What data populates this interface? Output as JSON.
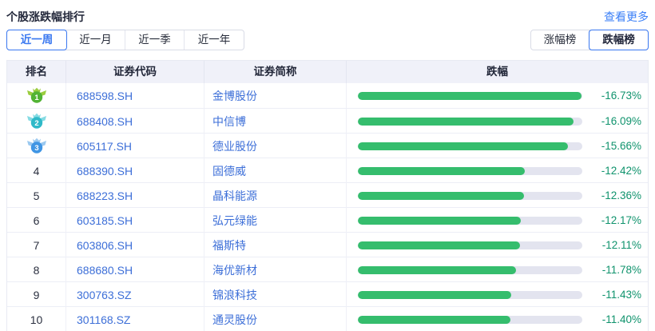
{
  "header": {
    "title": "个股涨跌幅排行",
    "more_link": "查看更多"
  },
  "tabs": {
    "items": [
      {
        "label": "近一周",
        "active": true
      },
      {
        "label": "近一月",
        "active": false
      },
      {
        "label": "近一季",
        "active": false
      },
      {
        "label": "近一年",
        "active": false
      }
    ]
  },
  "toggle": {
    "items": [
      {
        "label": "涨幅榜",
        "active": false
      },
      {
        "label": "跌幅榜",
        "active": true
      }
    ]
  },
  "table": {
    "columns": [
      "排名",
      "证券代码",
      "证券简称",
      "跌幅"
    ],
    "rows": [
      {
        "rank": 1,
        "code": "688598.SH",
        "name": "金博股份",
        "change": "-16.73%",
        "bar_pct": 99.5,
        "medal": {
          "body": "#52b334",
          "wing": "#9bcd3f"
        }
      },
      {
        "rank": 2,
        "code": "688408.SH",
        "name": "中信博",
        "change": "-16.09%",
        "bar_pct": 96.2,
        "medal": {
          "body": "#2fb9c8",
          "wing": "#85dbe3"
        }
      },
      {
        "rank": 3,
        "code": "605117.SH",
        "name": "德业股份",
        "change": "-15.66%",
        "bar_pct": 93.6,
        "medal": {
          "body": "#3f95e4",
          "wing": "#9bc9f0"
        }
      },
      {
        "rank": 4,
        "code": "688390.SH",
        "name": "固德威",
        "change": "-12.42%",
        "bar_pct": 74.2,
        "medal": null
      },
      {
        "rank": 5,
        "code": "688223.SH",
        "name": "晶科能源",
        "change": "-12.36%",
        "bar_pct": 73.9,
        "medal": null
      },
      {
        "rank": 6,
        "code": "603185.SH",
        "name": "弘元绿能",
        "change": "-12.17%",
        "bar_pct": 72.7,
        "medal": null
      },
      {
        "rank": 7,
        "code": "603806.SH",
        "name": "福斯特",
        "change": "-12.11%",
        "bar_pct": 72.4,
        "medal": null
      },
      {
        "rank": 8,
        "code": "688680.SH",
        "name": "海优新材",
        "change": "-11.78%",
        "bar_pct": 70.4,
        "medal": null
      },
      {
        "rank": 9,
        "code": "300763.SZ",
        "name": "锦浪科技",
        "change": "-11.43%",
        "bar_pct": 68.3,
        "medal": null
      },
      {
        "rank": 10,
        "code": "301168.SZ",
        "name": "通灵股份",
        "change": "-11.40%",
        "bar_pct": 68.1,
        "medal": null
      }
    ]
  },
  "colors": {
    "accent_blue": "#3a78f0",
    "link_blue": "#3d6fd8",
    "bar_green": "#35bd6d",
    "bar_track": "#e3e4ef",
    "pct_green": "#10936d",
    "header_bg": "#f0f1f9"
  }
}
